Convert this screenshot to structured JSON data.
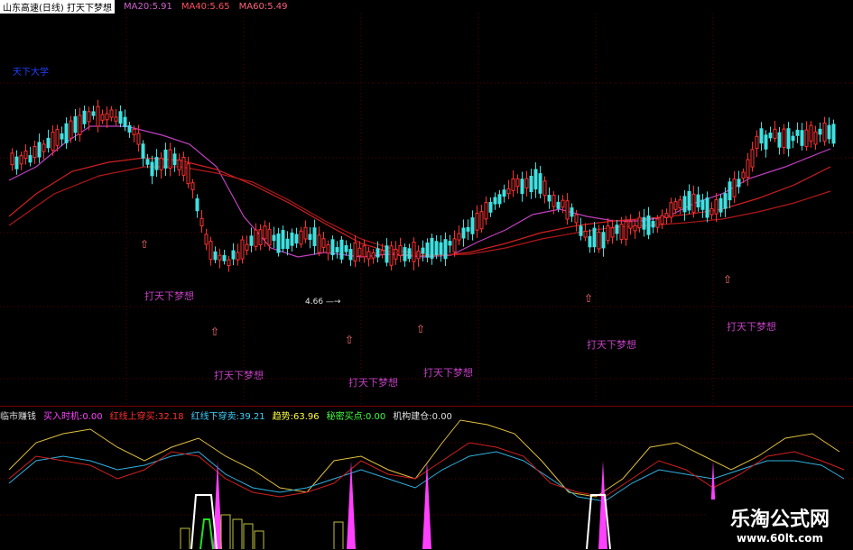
{
  "main_panel": {
    "header": {
      "stock_title": "山东高速(日线)",
      "formula_name": "打天下梦想",
      "ma20": "MA20:5.91",
      "ma40": "MA40:5.65",
      "ma60": "MA60:5.49"
    },
    "corner_label": "天下大学",
    "price_note": "4.66",
    "signal_label": "打天下梦想"
  },
  "sub_panel": {
    "indicator_name": "临市赚钱",
    "buy_timing": "买入时机:0.00",
    "red_up": "红线上穿买:32.18",
    "red_down": "红线下穿卖:39.21",
    "trend": "趋势:63.96",
    "secret_buy": "秘密买点:0.00",
    "institution": "机构建仓:0.00"
  },
  "watermark": {
    "title": "乐淘公式网",
    "url": "www.60lt.com"
  }
}
